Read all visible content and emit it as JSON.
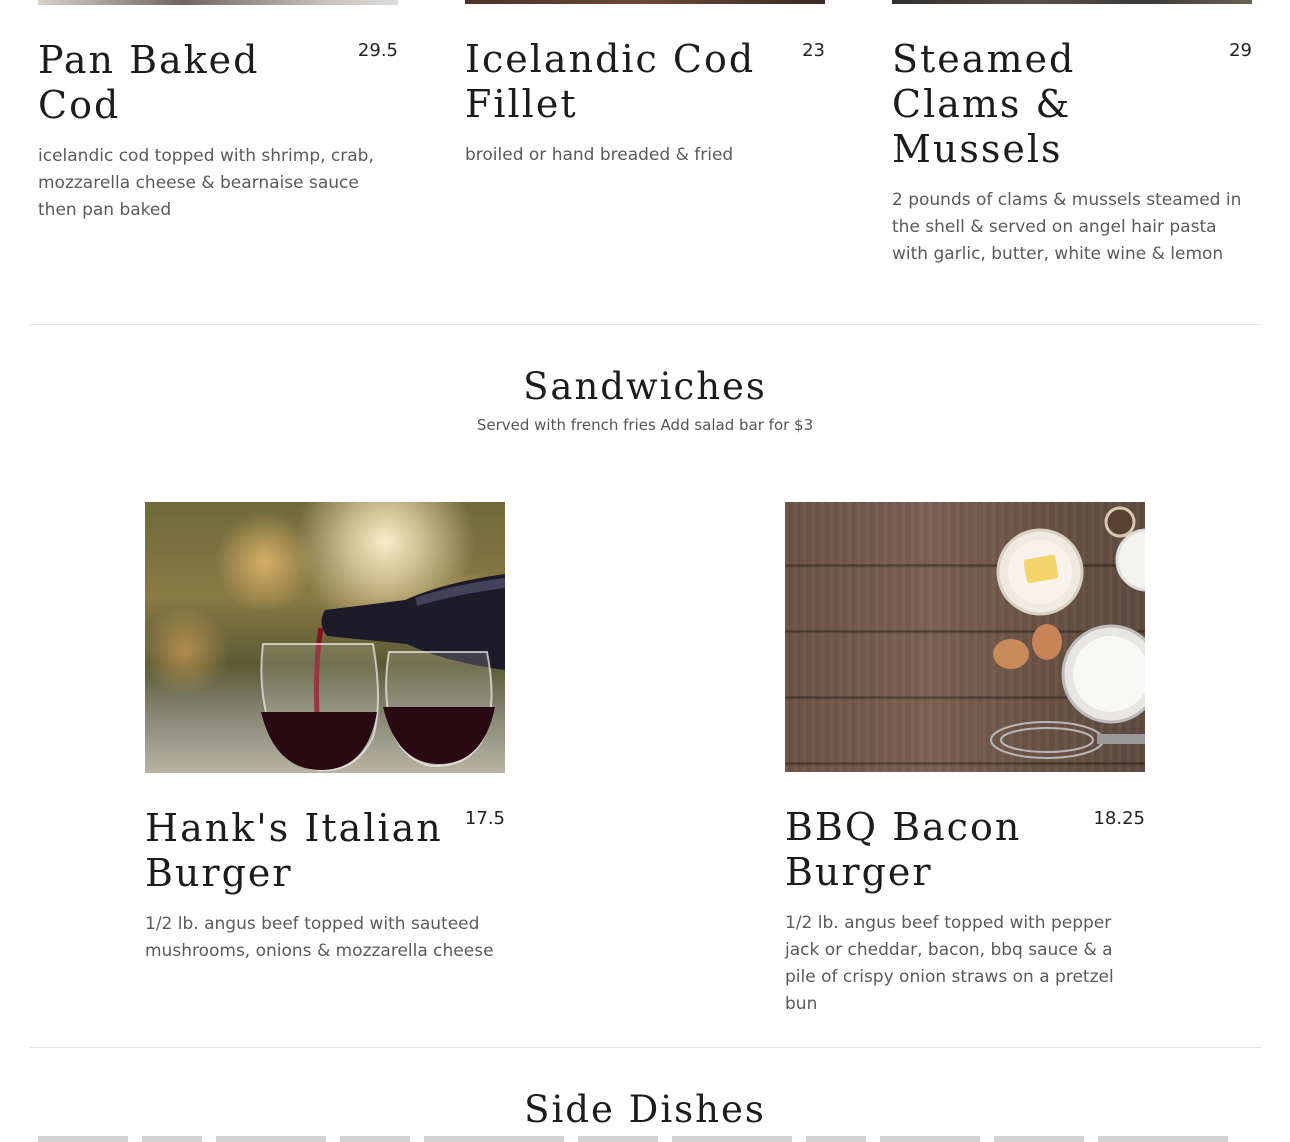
{
  "top_items": [
    {
      "title": "Pan Baked\nCod",
      "price": "29.5",
      "description": "icelandic cod topped with shrimp, crab, mozzarella cheese & bearnaise sauce then pan baked"
    },
    {
      "title": "Icelandic Cod\nFillet",
      "price": "23",
      "description": "broiled or hand breaded & fried"
    },
    {
      "title": "Steamed\nClams &\nMussels",
      "price": "29",
      "description": "2 pounds of clams & mussels steamed in the shell & served on angel hair pasta with garlic, butter, white wine & lemon"
    }
  ],
  "sandwiches": {
    "title": "Sandwiches",
    "subtitle": "Served with french fries Add salad bar for $3",
    "items": [
      {
        "title": "Hank's Italian\nBurger",
        "price": "17.5",
        "description": "1/2 lb. angus beef topped with sauteed mushrooms, onions & mozzarella cheese",
        "image_icon": "wine-pour-photo"
      },
      {
        "title": "BBQ Bacon\nBurger",
        "price": "18.25",
        "description": "1/2 lb. angus beef topped with pepper jack or cheddar, bacon, bbq sauce & a pile of crispy onion straws on a pretzel bun",
        "image_icon": "baking-ingredients-photo"
      }
    ]
  },
  "side_dishes": {
    "title": "Side Dishes"
  }
}
